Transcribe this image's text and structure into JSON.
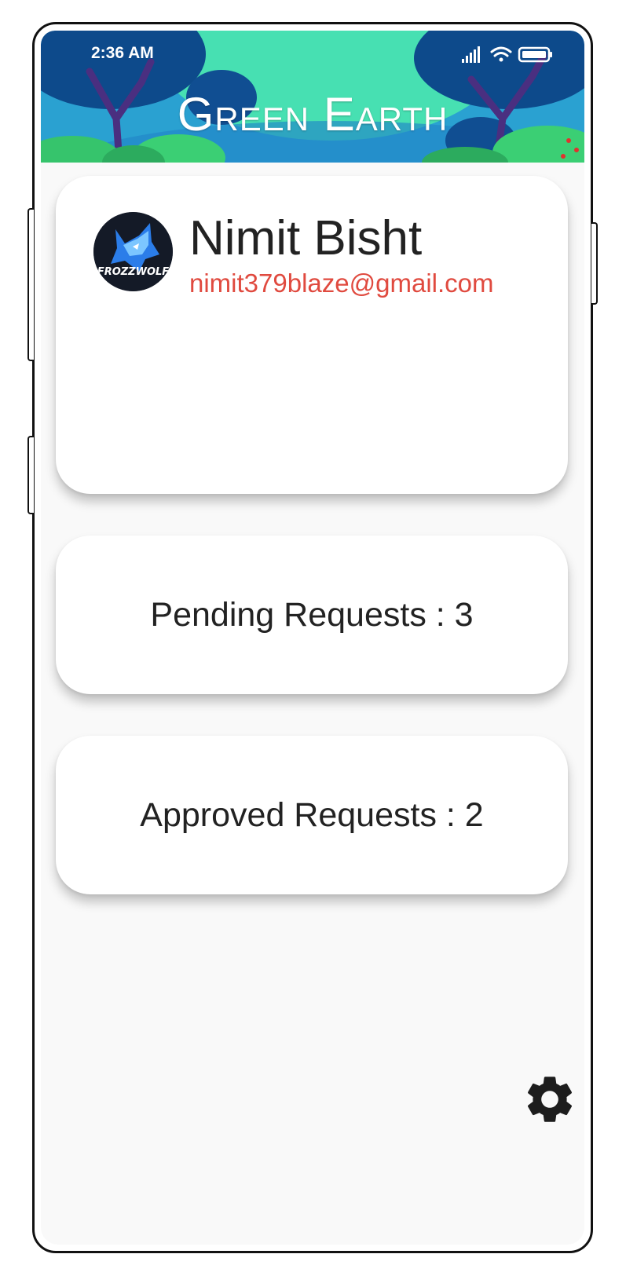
{
  "status_bar": {
    "time": "2:36 AM"
  },
  "header": {
    "title": "Green Earth"
  },
  "profile": {
    "name": "Nimit Bisht",
    "email": "nimit379blaze@gmail.com",
    "avatar_text": "FROZZWOLF"
  },
  "stats": {
    "pending_label": "Pending Requests : 3",
    "approved_label": "Approved Requests : 2"
  },
  "icons": {
    "settings": "gear-icon",
    "signal": "signal-icon",
    "wifi": "wifi-icon",
    "battery": "battery-icon"
  },
  "colors": {
    "email": "#e04a3f",
    "screen_background": "#f9f9f9",
    "header_sky": "#2aa1d1",
    "header_sun": "#47e0b2"
  }
}
